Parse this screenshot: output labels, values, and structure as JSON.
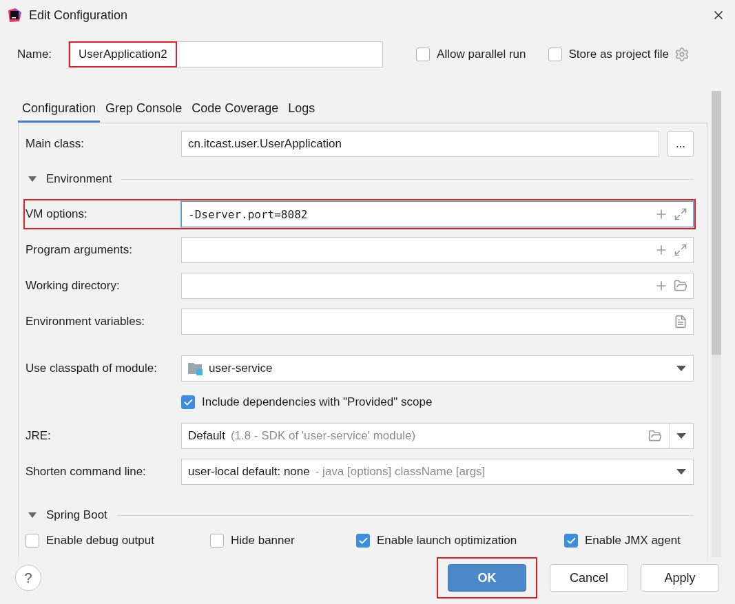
{
  "window": {
    "title": "Edit Configuration"
  },
  "name_field": {
    "label": "Name:",
    "value": "UserApplication2",
    "highlighted": true
  },
  "options": [
    {
      "label": "Allow parallel run",
      "checked": false
    },
    {
      "label": "Store as project file",
      "checked": false
    }
  ],
  "tabs": [
    {
      "label": "Configuration",
      "selected": true
    },
    {
      "label": "Grep Console",
      "selected": false
    },
    {
      "label": "Code Coverage",
      "selected": false
    },
    {
      "label": "Logs",
      "selected": false
    }
  ],
  "rows": [
    {
      "kind": "class",
      "label": "Main class:",
      "value": "cn.itcast.user.UserApplication",
      "button": "..."
    },
    {
      "kind": "section",
      "label": "Environment",
      "expanded": true
    },
    {
      "kind": "code",
      "label": "VM options:",
      "value": "-Dserver.port=8082",
      "highlighted": true
    },
    {
      "kind": "args",
      "label": "Program arguments:",
      "value": ""
    },
    {
      "kind": "path",
      "label": "Working directory:",
      "value": ""
    },
    {
      "kind": "env",
      "label": "Environment variables:",
      "value": ""
    },
    {
      "kind": "module",
      "label": "Use classpath of module:",
      "value": "user-service"
    },
    {
      "kind": "checkbox",
      "label": "Include dependencies with \"Provided\" scope",
      "checked": true
    },
    {
      "kind": "jre",
      "label": "JRE:",
      "value": "Default",
      "hint": "(1.8 - SDK of 'user-service' module)"
    },
    {
      "kind": "combo",
      "label": "Shorten command line:",
      "value": "user-local default: none",
      "hint": "- java [options] className [args]"
    },
    {
      "kind": "section",
      "label": "Spring Boot",
      "expanded": true
    },
    {
      "kind": "checkrow",
      "items": [
        {
          "label": "Enable debug output",
          "checked": false
        },
        {
          "label": "Hide banner",
          "checked": false
        },
        {
          "label": "Enable launch optimization",
          "checked": true
        },
        {
          "label": "Enable JMX agent",
          "checked": true
        }
      ]
    }
  ],
  "help": {
    "label": "?"
  },
  "buttons": [
    {
      "label": "OK",
      "default": true,
      "highlighted": true
    },
    {
      "label": "Cancel",
      "default": false,
      "highlighted": false
    },
    {
      "label": "Apply",
      "default": false,
      "highlighted": false
    }
  ]
}
